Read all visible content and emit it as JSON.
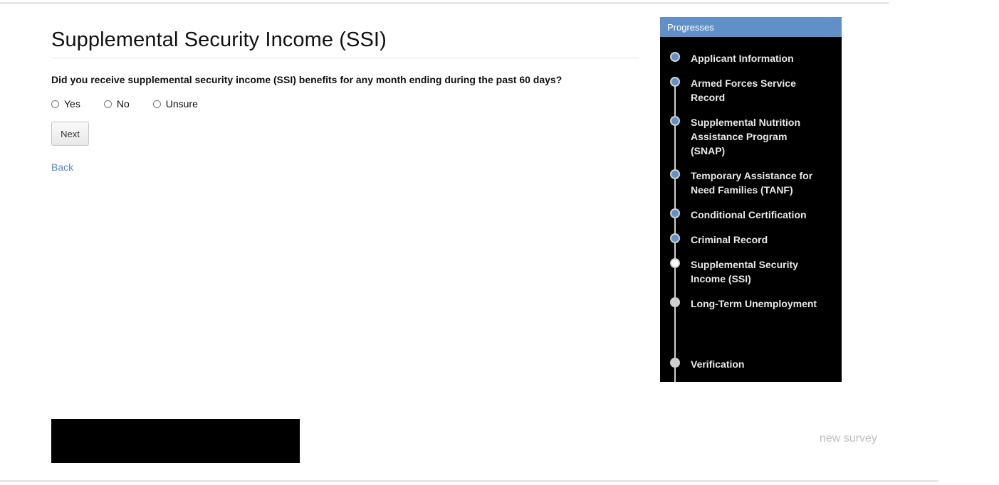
{
  "page": {
    "title": "Supplemental Security Income (SSI)",
    "question": "Did you receive supplemental security income (SSI) benefits for any month ending during the past 60 days?",
    "options": [
      "Yes",
      "No",
      "Unsure"
    ],
    "next_label": "Next",
    "back_label": "Back"
  },
  "sidebar": {
    "header": "Progresses",
    "steps": [
      {
        "label": "Applicant Information",
        "status": "done"
      },
      {
        "label": "Armed Forces Service Record",
        "status": "done"
      },
      {
        "label": "Supplemental Nutrition Assistance Program (SNAP)",
        "status": "done"
      },
      {
        "label": "Temporary Assistance for Need Families (TANF)",
        "status": "done"
      },
      {
        "label": "Conditional Certification",
        "status": "done"
      },
      {
        "label": "Criminal Record",
        "status": "done"
      },
      {
        "label": "Supplemental Security Income (SSI)",
        "status": "current"
      },
      {
        "label": "Long-Term Unemployment",
        "status": "todo"
      },
      {
        "label": "Verification",
        "status": "todo"
      }
    ]
  },
  "footer": {
    "new_survey_label": "new survey"
  },
  "colors": {
    "accent": "#6190c8",
    "link": "#5a87c0",
    "sidebar_bg": "#000000"
  }
}
